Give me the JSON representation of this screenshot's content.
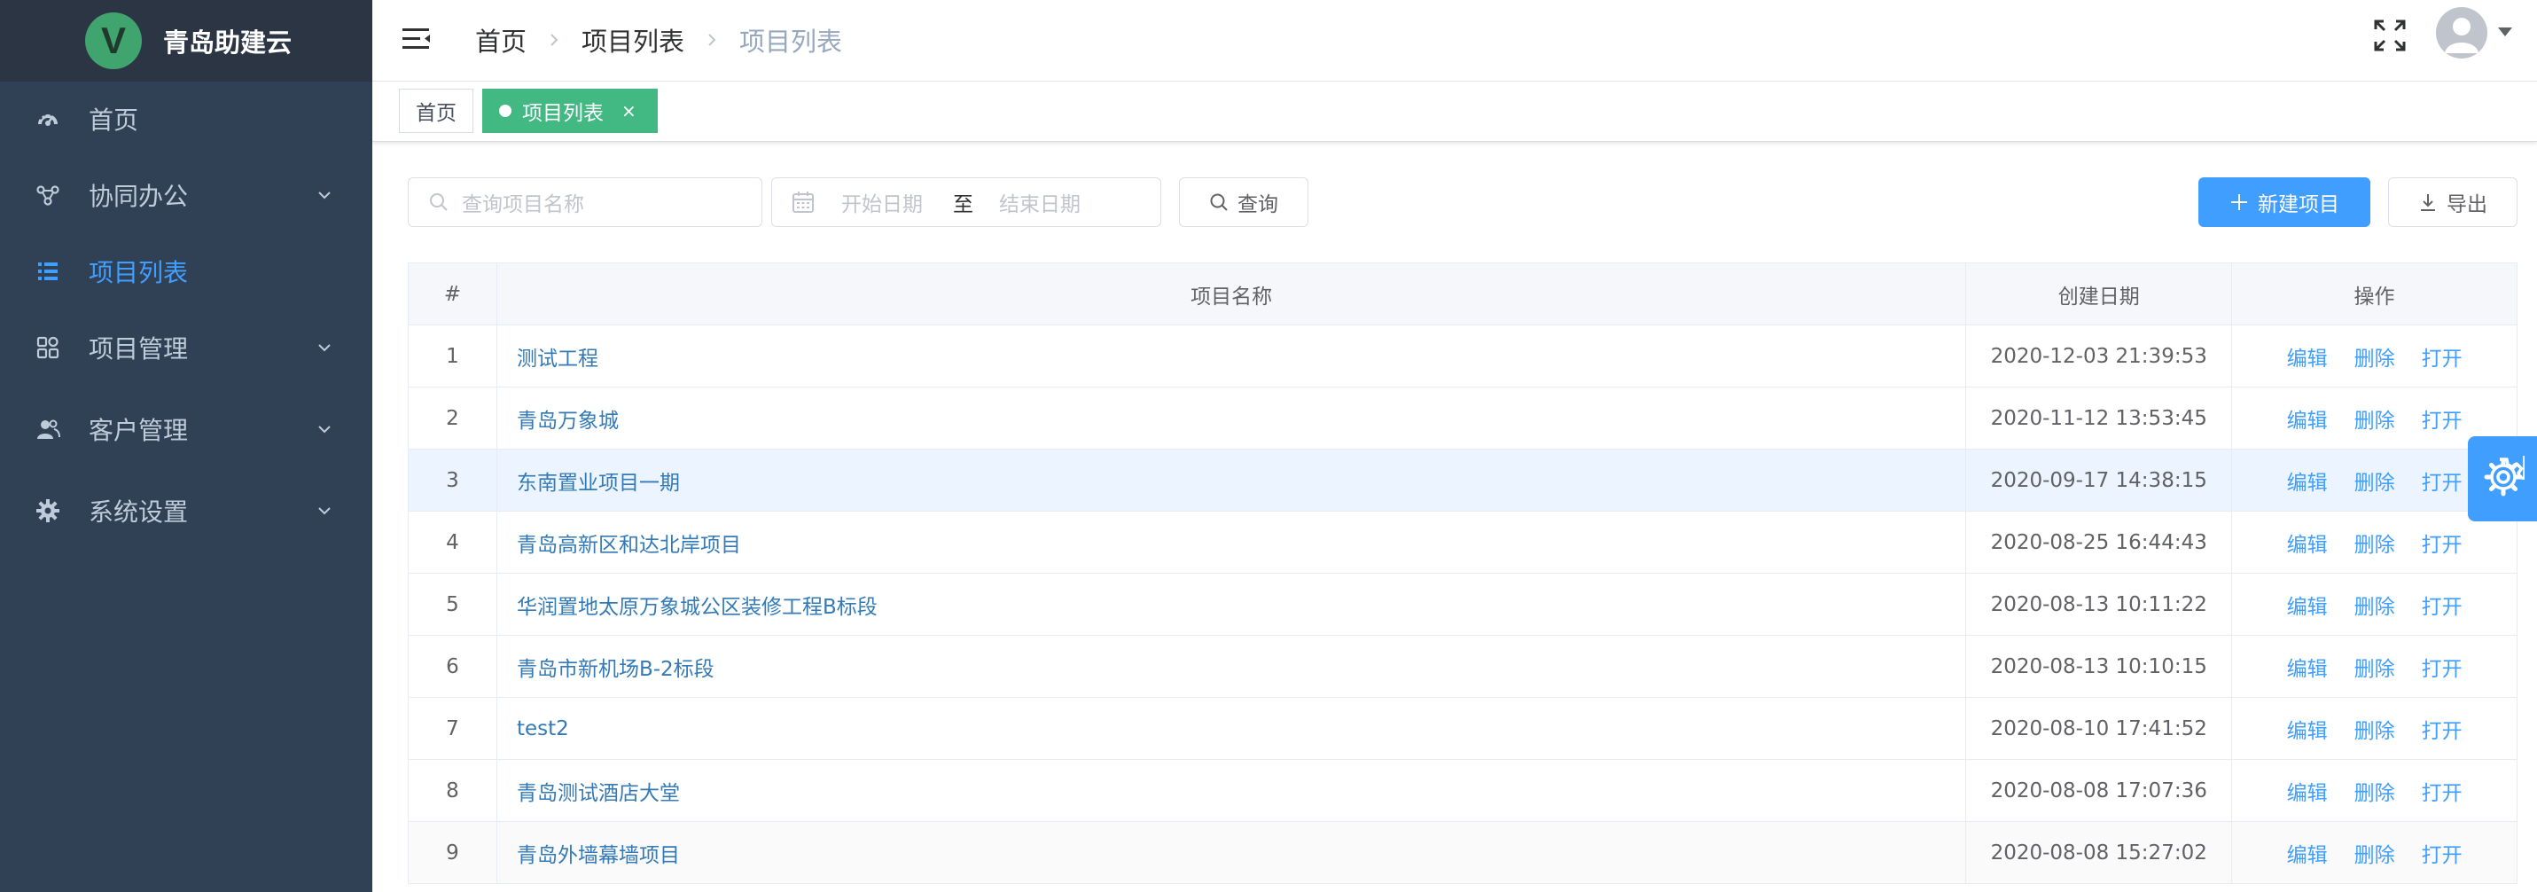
{
  "app": {
    "title": "青岛助建云",
    "logo_letter": "V"
  },
  "sidebar": {
    "items": [
      {
        "label": "首页",
        "icon": "dashboard-icon",
        "active": false,
        "expandable": false
      },
      {
        "label": "协同办公",
        "icon": "share-icon",
        "active": false,
        "expandable": true
      },
      {
        "label": "项目列表",
        "icon": "list-icon",
        "active": true,
        "expandable": false
      },
      {
        "label": "项目管理",
        "icon": "grid-icon",
        "active": false,
        "expandable": true
      },
      {
        "label": "客户管理",
        "icon": "users-icon",
        "active": false,
        "expandable": true
      },
      {
        "label": "系统设置",
        "icon": "gear-icon",
        "active": false,
        "expandable": true
      }
    ]
  },
  "header": {
    "breadcrumb": [
      "首页",
      "项目列表",
      "项目列表"
    ]
  },
  "tags": {
    "home": "首页",
    "active": "项目列表",
    "close": "×"
  },
  "toolbar": {
    "search_placeholder": "查询项目名称",
    "date_start_placeholder": "开始日期",
    "date_separator": "至",
    "date_end_placeholder": "结束日期",
    "query_label": "查询",
    "new_label": "新建项目",
    "export_label": "导出"
  },
  "table": {
    "headers": {
      "index": "#",
      "name": "项目名称",
      "date": "创建日期",
      "ops": "操作"
    },
    "ops": {
      "edit": "编辑",
      "delete": "删除",
      "open": "打开"
    },
    "rows": [
      {
        "index": "1",
        "name": "测试工程",
        "date": "2020-12-03 21:39:53"
      },
      {
        "index": "2",
        "name": "青岛万象城",
        "date": "2020-11-12 13:53:45"
      },
      {
        "index": "3",
        "name": "东南置业项目一期",
        "date": "2020-09-17 14:38:15"
      },
      {
        "index": "4",
        "name": "青岛高新区和达北岸项目",
        "date": "2020-08-25 16:44:43"
      },
      {
        "index": "5",
        "name": "华润置地太原万象城公区装修工程B标段",
        "date": "2020-08-13 10:11:22"
      },
      {
        "index": "6",
        "name": "青岛市新机场B-2标段",
        "date": "2020-08-13 10:10:15"
      },
      {
        "index": "7",
        "name": "test2",
        "date": "2020-08-10 17:41:52"
      },
      {
        "index": "8",
        "name": "青岛测试酒店大堂",
        "date": "2020-08-08 17:07:36"
      },
      {
        "index": "9",
        "name": "青岛外墙幕墙项目",
        "date": "2020-08-08 15:27:02"
      }
    ]
  },
  "colors": {
    "sidebar_bg": "#304156",
    "brand_bg": "#2b3544",
    "accent": "#409eff",
    "tag_active": "#42b983",
    "link": "#337ab7"
  }
}
